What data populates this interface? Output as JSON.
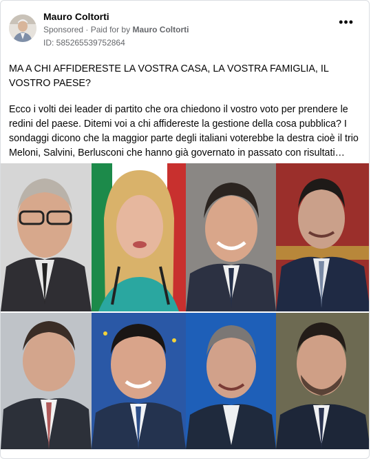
{
  "post": {
    "author": "Mauro Coltorti",
    "sponsored": "Sponsored",
    "paid_for_by_label": "Paid for by",
    "paid_for_by": "Mauro Coltorti",
    "id_line": "ID: 585265539752864",
    "more_icon": "more-horizontal-icon",
    "headline": "MA A CHI AFFIDERESTE LA VOSTRA CASA, LA VOSTRA FAMIGLIA, IL VOSTRO PAESE?",
    "body": "Ecco i volti dei leader di partito che ora chiedono il vostro voto per prendere le redini del paese. Ditemi voi a chi affidereste la gestione della cosa pubblica? I sondaggi dicono che la maggior parte degli italiani voterebbe la destra cioè il trio Meloni, Salvini, Berlusconi che hanno già governato in passato con risultati…"
  },
  "colors": {
    "text": "#050505",
    "secondary_text": "#65676b",
    "border": "#dadde1"
  }
}
